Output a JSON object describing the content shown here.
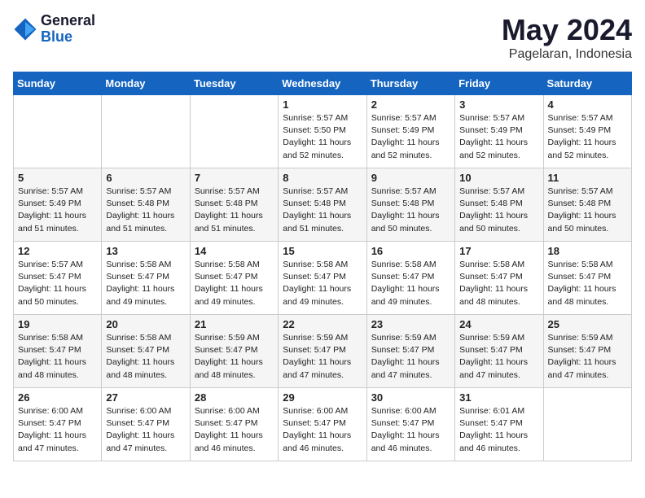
{
  "logo": {
    "general": "General",
    "blue": "Blue"
  },
  "title": "May 2024",
  "location": "Pagelaran, Indonesia",
  "days_of_week": [
    "Sunday",
    "Monday",
    "Tuesday",
    "Wednesday",
    "Thursday",
    "Friday",
    "Saturday"
  ],
  "weeks": [
    [
      {
        "day": "",
        "info": ""
      },
      {
        "day": "",
        "info": ""
      },
      {
        "day": "",
        "info": ""
      },
      {
        "day": "1",
        "info": "Sunrise: 5:57 AM\nSunset: 5:50 PM\nDaylight: 11 hours\nand 52 minutes."
      },
      {
        "day": "2",
        "info": "Sunrise: 5:57 AM\nSunset: 5:49 PM\nDaylight: 11 hours\nand 52 minutes."
      },
      {
        "day": "3",
        "info": "Sunrise: 5:57 AM\nSunset: 5:49 PM\nDaylight: 11 hours\nand 52 minutes."
      },
      {
        "day": "4",
        "info": "Sunrise: 5:57 AM\nSunset: 5:49 PM\nDaylight: 11 hours\nand 52 minutes."
      }
    ],
    [
      {
        "day": "5",
        "info": "Sunrise: 5:57 AM\nSunset: 5:49 PM\nDaylight: 11 hours\nand 51 minutes."
      },
      {
        "day": "6",
        "info": "Sunrise: 5:57 AM\nSunset: 5:48 PM\nDaylight: 11 hours\nand 51 minutes."
      },
      {
        "day": "7",
        "info": "Sunrise: 5:57 AM\nSunset: 5:48 PM\nDaylight: 11 hours\nand 51 minutes."
      },
      {
        "day": "8",
        "info": "Sunrise: 5:57 AM\nSunset: 5:48 PM\nDaylight: 11 hours\nand 51 minutes."
      },
      {
        "day": "9",
        "info": "Sunrise: 5:57 AM\nSunset: 5:48 PM\nDaylight: 11 hours\nand 50 minutes."
      },
      {
        "day": "10",
        "info": "Sunrise: 5:57 AM\nSunset: 5:48 PM\nDaylight: 11 hours\nand 50 minutes."
      },
      {
        "day": "11",
        "info": "Sunrise: 5:57 AM\nSunset: 5:48 PM\nDaylight: 11 hours\nand 50 minutes."
      }
    ],
    [
      {
        "day": "12",
        "info": "Sunrise: 5:57 AM\nSunset: 5:47 PM\nDaylight: 11 hours\nand 50 minutes."
      },
      {
        "day": "13",
        "info": "Sunrise: 5:58 AM\nSunset: 5:47 PM\nDaylight: 11 hours\nand 49 minutes."
      },
      {
        "day": "14",
        "info": "Sunrise: 5:58 AM\nSunset: 5:47 PM\nDaylight: 11 hours\nand 49 minutes."
      },
      {
        "day": "15",
        "info": "Sunrise: 5:58 AM\nSunset: 5:47 PM\nDaylight: 11 hours\nand 49 minutes."
      },
      {
        "day": "16",
        "info": "Sunrise: 5:58 AM\nSunset: 5:47 PM\nDaylight: 11 hours\nand 49 minutes."
      },
      {
        "day": "17",
        "info": "Sunrise: 5:58 AM\nSunset: 5:47 PM\nDaylight: 11 hours\nand 48 minutes."
      },
      {
        "day": "18",
        "info": "Sunrise: 5:58 AM\nSunset: 5:47 PM\nDaylight: 11 hours\nand 48 minutes."
      }
    ],
    [
      {
        "day": "19",
        "info": "Sunrise: 5:58 AM\nSunset: 5:47 PM\nDaylight: 11 hours\nand 48 minutes."
      },
      {
        "day": "20",
        "info": "Sunrise: 5:58 AM\nSunset: 5:47 PM\nDaylight: 11 hours\nand 48 minutes."
      },
      {
        "day": "21",
        "info": "Sunrise: 5:59 AM\nSunset: 5:47 PM\nDaylight: 11 hours\nand 48 minutes."
      },
      {
        "day": "22",
        "info": "Sunrise: 5:59 AM\nSunset: 5:47 PM\nDaylight: 11 hours\nand 47 minutes."
      },
      {
        "day": "23",
        "info": "Sunrise: 5:59 AM\nSunset: 5:47 PM\nDaylight: 11 hours\nand 47 minutes."
      },
      {
        "day": "24",
        "info": "Sunrise: 5:59 AM\nSunset: 5:47 PM\nDaylight: 11 hours\nand 47 minutes."
      },
      {
        "day": "25",
        "info": "Sunrise: 5:59 AM\nSunset: 5:47 PM\nDaylight: 11 hours\nand 47 minutes."
      }
    ],
    [
      {
        "day": "26",
        "info": "Sunrise: 6:00 AM\nSunset: 5:47 PM\nDaylight: 11 hours\nand 47 minutes."
      },
      {
        "day": "27",
        "info": "Sunrise: 6:00 AM\nSunset: 5:47 PM\nDaylight: 11 hours\nand 47 minutes."
      },
      {
        "day": "28",
        "info": "Sunrise: 6:00 AM\nSunset: 5:47 PM\nDaylight: 11 hours\nand 46 minutes."
      },
      {
        "day": "29",
        "info": "Sunrise: 6:00 AM\nSunset: 5:47 PM\nDaylight: 11 hours\nand 46 minutes."
      },
      {
        "day": "30",
        "info": "Sunrise: 6:00 AM\nSunset: 5:47 PM\nDaylight: 11 hours\nand 46 minutes."
      },
      {
        "day": "31",
        "info": "Sunrise: 6:01 AM\nSunset: 5:47 PM\nDaylight: 11 hours\nand 46 minutes."
      },
      {
        "day": "",
        "info": ""
      }
    ]
  ]
}
